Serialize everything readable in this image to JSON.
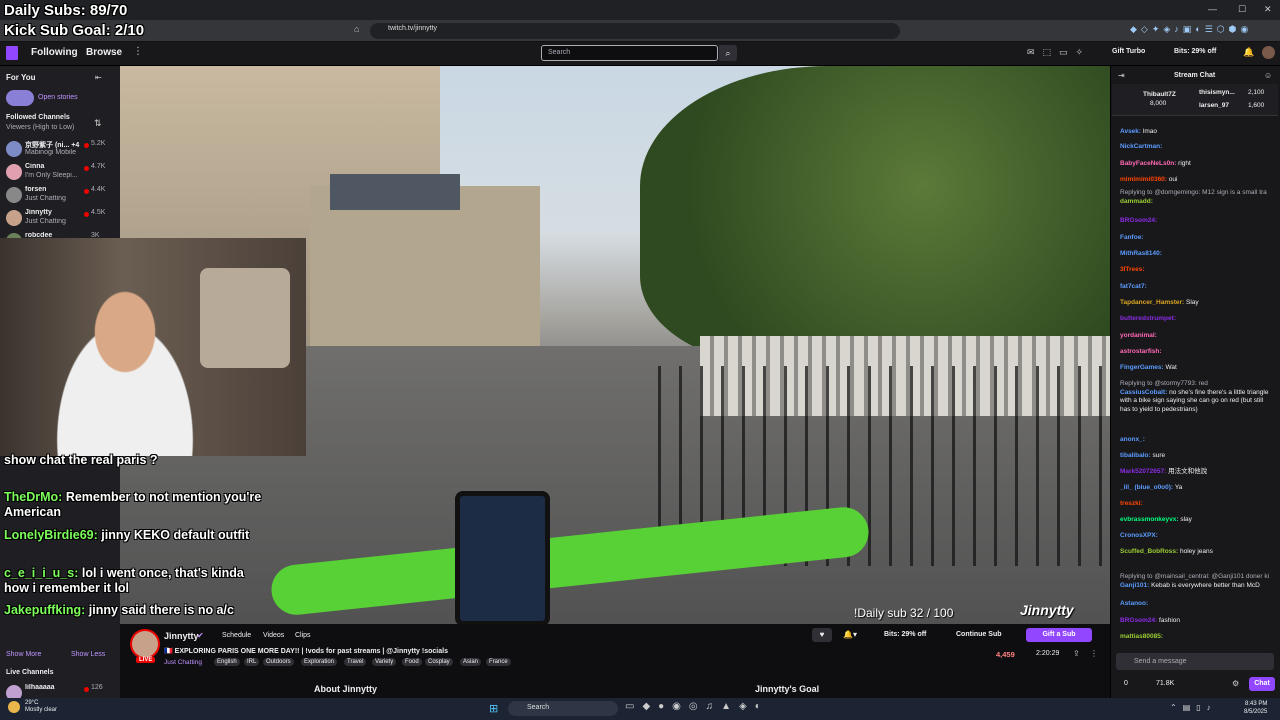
{
  "overlay": {
    "daily_subs": "Daily Subs: 89/70",
    "kick_goal": "Kick Sub Goal: 2/10"
  },
  "browser": {
    "url": "twitch.tv/jinnytty"
  },
  "nav": {
    "following": "Following",
    "browse": "Browse",
    "more": "⋮",
    "search_placeholder": "Search",
    "gift_turbo": "Gift Turbo",
    "bits": "Bits: 29% off"
  },
  "sidebar": {
    "title": "For You",
    "open_stories": "Open stories",
    "followed": "Followed Channels",
    "sort": "Viewers (High to Low)",
    "channels": [
      {
        "name": "京野紫子 (ni... +4",
        "game": "Mabinogi Mobile",
        "viewers": "5.2K",
        "color": "#7d8cc4"
      },
      {
        "name": "Cinna",
        "game": "I'm Only Sleepi...",
        "viewers": "4.7K",
        "color": "#e0a0b0"
      },
      {
        "name": "forsen",
        "game": "Just Chatting",
        "viewers": "4.4K",
        "color": "#888888"
      },
      {
        "name": "Jinnytty",
        "game": "Just Chatting",
        "viewers": "4.5K",
        "color": "#c7a18a"
      },
      {
        "name": "robcdee",
        "game": "",
        "viewers": "3K",
        "color": "#6a7f5a"
      }
    ],
    "show_more": "Show More",
    "show_less": "Show Less",
    "live_channels": "Live Channels",
    "live_item": {
      "name": "lilhaaaaa",
      "viewers": "126"
    }
  },
  "video": {
    "daily_sub": "!Daily sub 32 / 100",
    "watermark": "Jinnytty"
  },
  "overlay_chat": [
    {
      "user": "",
      "text": "show chat the real paris ?"
    },
    {
      "user": "TheDrMo:",
      "text": "Remember to not mention you're American"
    },
    {
      "user": "LonelyBirdie69:",
      "text": "jinny KEKO default outfit"
    },
    {
      "user": "c_e_i_i_u_s:",
      "text": "lol i went once, that's kinda how i remember it lol"
    },
    {
      "user": "Jakepuffking:",
      "text": "jinny said there is no a/c"
    }
  ],
  "channel": {
    "name": "Jinnytty",
    "live": "LIVE",
    "tabs": [
      "Schedule",
      "Videos",
      "Clips"
    ],
    "title": "🇫🇷 EXPLORING PARIS ONE MORE DAY!! | !vods for past streams | @Jinnytty !socials",
    "category": "Just Chatting",
    "tags": [
      "English",
      "IRL",
      "Outdoors",
      "Exploration",
      "Travel",
      "Variety",
      "Food",
      "Cosplay",
      "Asian",
      "France"
    ],
    "bits": "Bits: 29% off",
    "continue_sub": "Continue Sub",
    "gift_sub": "Gift a Sub",
    "viewers": "4,459",
    "uptime": "2:20:29",
    "about": "About Jinnytty",
    "goal": "Jinnytty's Goal"
  },
  "chat": {
    "title": "Stream Chat",
    "leaders": [
      {
        "name": "Thibault7Z",
        "value": "8,000"
      },
      {
        "name": "thisismyn...",
        "value": "2,100"
      },
      {
        "name": "larsen_97",
        "value": "1,600"
      }
    ],
    "messages": [
      {
        "user": "Avsek:",
        "text": "lmao",
        "color": "#5c9cff",
        "reply": ""
      },
      {
        "user": "NickCartman:",
        "text": "",
        "color": "#5c9cff",
        "reply": ""
      },
      {
        "user": "BabyFaceNeLs0n:",
        "text": "right",
        "color": "#ff69b4",
        "reply": ""
      },
      {
        "user": "mimimimi0360:",
        "text": "oui",
        "color": "#ff4500",
        "reply": ""
      },
      {
        "user": "dammadd:",
        "text": "",
        "color": "#9acd32",
        "reply": "Replying to @domgemingo: M12 sign is a small tra"
      },
      {
        "user": "BRGsom24:",
        "text": "",
        "color": "#8a2be2",
        "reply": ""
      },
      {
        "user": "Fanfoe:",
        "text": "",
        "color": "#5c9cff",
        "reply": ""
      },
      {
        "user": "MithRas8140:",
        "text": "",
        "color": "#5c9cff",
        "reply": ""
      },
      {
        "user": "3lTrees:",
        "text": "",
        "color": "#ff4500",
        "reply": ""
      },
      {
        "user": "fat7cat7:",
        "text": "",
        "color": "#5c9cff",
        "reply": ""
      },
      {
        "user": "Tapdancer_Hamster:",
        "text": "Slay",
        "color": "#daa520",
        "reply": ""
      },
      {
        "user": "butteredstrumpet:",
        "text": "",
        "color": "#8a2be2",
        "reply": ""
      },
      {
        "user": "yordanimal:",
        "text": "",
        "color": "#ff69b4",
        "reply": ""
      },
      {
        "user": "astrostarfish:",
        "text": "",
        "color": "#ff69b4",
        "reply": ""
      },
      {
        "user": "FingerGames:",
        "text": "Wat",
        "color": "#5c9cff",
        "reply": ""
      },
      {
        "user": "CassiusCobalt:",
        "text": "no she's fine there's a little triangle with a bike sign saying she can go on red (but still has to yield to pedestrians)",
        "color": "#5c9cff",
        "reply": "Replying to @stormy7793: red"
      },
      {
        "user": "anonx_:",
        "text": "",
        "color": "#5c9cff",
        "reply": ""
      },
      {
        "user": "tibalibalo:",
        "text": "sure",
        "color": "#5c9cff",
        "reply": ""
      },
      {
        "user": "Mark52072657:",
        "text": "用法文和他說",
        "color": "#8a2be2",
        "reply": ""
      },
      {
        "user": "_ill_ (blue_o0o0):",
        "text": "Ya",
        "color": "#5c9cff",
        "reply": ""
      },
      {
        "user": "treszki:",
        "text": "",
        "color": "#ff4500",
        "reply": ""
      },
      {
        "user": "evbrassmonkeyvx:",
        "text": "slay",
        "color": "#00ff7f",
        "reply": ""
      },
      {
        "user": "CronosXPX:",
        "text": "",
        "color": "#5c9cff",
        "reply": ""
      },
      {
        "user": "Scuffed_BobRoss:",
        "text": "holey jeans",
        "color": "#9acd32",
        "reply": ""
      },
      {
        "user": "Ganji101:",
        "text": "Kebab is everywhere better than McD",
        "color": "#5c9cff",
        "reply": "Replying to @mainsail_central: @Ganji101 doner ki"
      },
      {
        "user": "Astanoo:",
        "text": "",
        "color": "#5c9cff",
        "reply": ""
      },
      {
        "user": "BRGsom24:",
        "text": "fashion",
        "color": "#8a2be2",
        "reply": ""
      },
      {
        "user": "mattias80085:",
        "text": "",
        "color": "#9acd32",
        "reply": ""
      }
    ],
    "input_placeholder": "Send a message",
    "points_a": "0",
    "points_b": "71.8K",
    "chat_button": "Chat"
  },
  "taskbar": {
    "temp": "29°C",
    "weather": "Mostly clear",
    "search": "Search",
    "time": "8:43 PM",
    "date": "8/5/2025"
  }
}
